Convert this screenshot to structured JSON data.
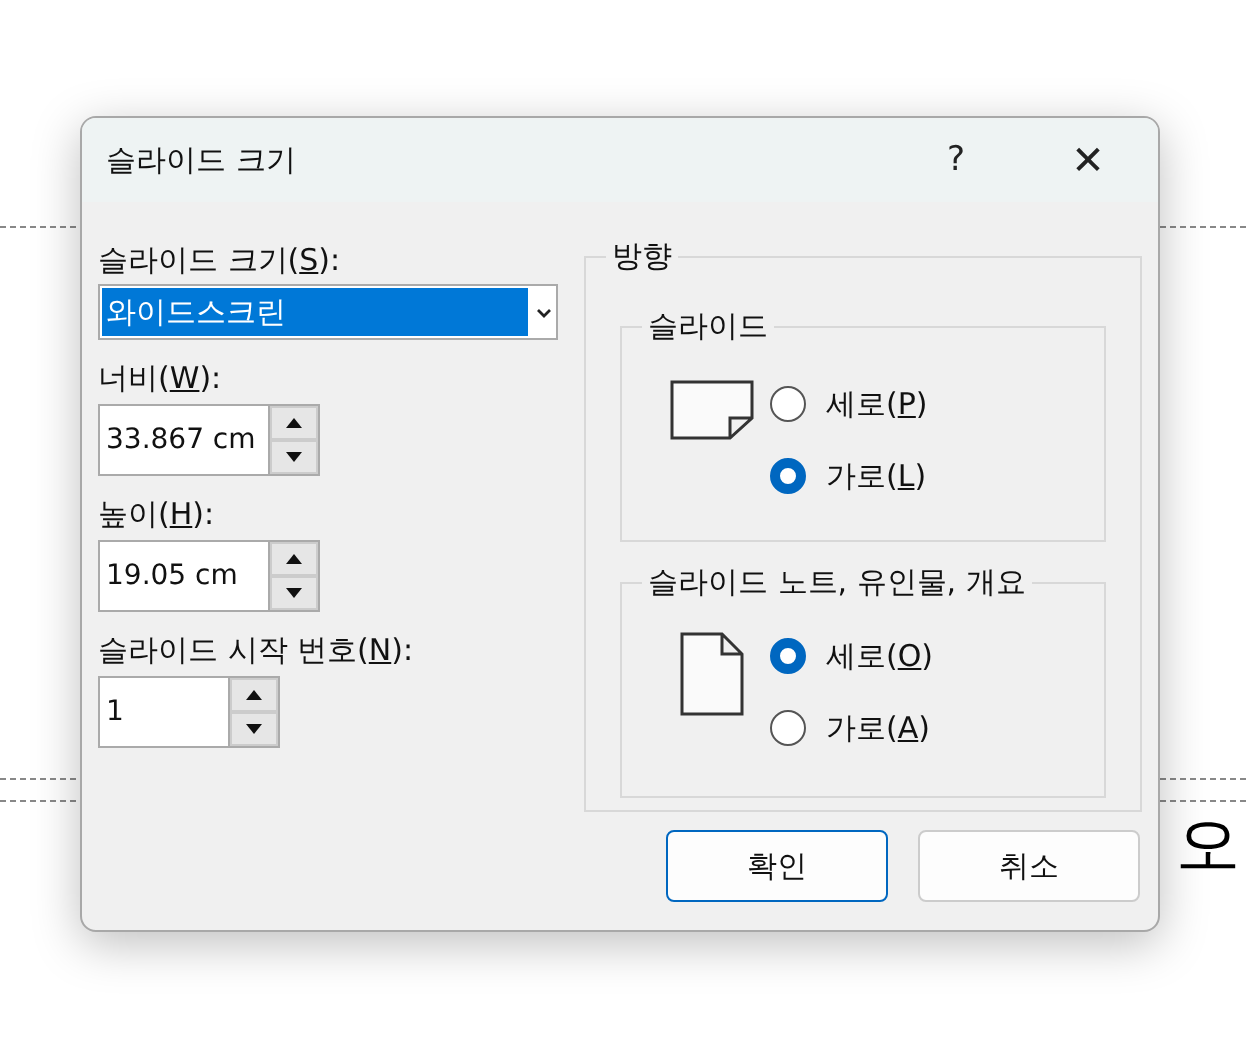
{
  "background": {
    "text": "오"
  },
  "dialog": {
    "title": "슬라이드 크기",
    "help": "?",
    "close": "✕"
  },
  "size": {
    "label": {
      "before": "슬라이드 크기(",
      "key": "S",
      "after": "):"
    },
    "value": "와이드스크린"
  },
  "fields": [
    {
      "label": {
        "before": "너비(",
        "key": "W",
        "after": "):"
      },
      "value": "33.867 cm",
      "kind": "wide"
    },
    {
      "label": {
        "before": "높이(",
        "key": "H",
        "after": "):"
      },
      "value": "19.05 cm",
      "kind": "wide"
    },
    {
      "label": {
        "before": "슬라이드 시작 번호(",
        "key": "N",
        "after": "):"
      },
      "value": "1",
      "kind": "narrow"
    }
  ],
  "orientation": {
    "title": "방향",
    "groups": [
      {
        "title": "슬라이드",
        "kind": "landscape",
        "options": [
          {
            "label": {
              "before": "세로(",
              "key": "P",
              "after": ")"
            },
            "selected": false
          },
          {
            "label": {
              "before": "가로(",
              "key": "L",
              "after": ")"
            },
            "selected": true
          }
        ]
      },
      {
        "title": "슬라이드 노트, 유인물, 개요",
        "kind": "portrait",
        "options": [
          {
            "label": {
              "before": "세로(",
              "key": "O",
              "after": ")"
            },
            "selected": true
          },
          {
            "label": {
              "before": "가로(",
              "key": "A",
              "after": ")"
            },
            "selected": false
          }
        ]
      }
    ]
  },
  "buttons": [
    {
      "label": "확인",
      "kind": "default"
    },
    {
      "label": "취소",
      "kind": "normal"
    }
  ]
}
